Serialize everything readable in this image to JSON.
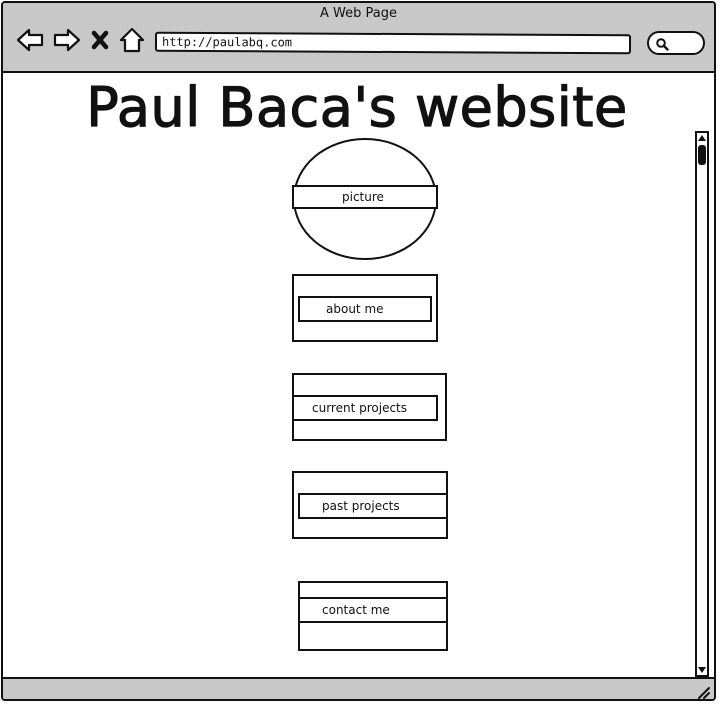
{
  "window": {
    "title": "A Web Page"
  },
  "toolbar": {
    "back_icon": "back-arrow-icon",
    "forward_icon": "forward-arrow-icon",
    "stop_icon": "close-icon",
    "home_icon": "home-icon",
    "url": "http://paulabq.com",
    "search_icon": "search-icon"
  },
  "page": {
    "title": "Paul Baca's website",
    "picture_label": "picture",
    "sections": [
      {
        "label": "about me"
      },
      {
        "label": "current projects"
      },
      {
        "label": "past projects"
      },
      {
        "label": "contact me"
      }
    ]
  },
  "colors": {
    "chrome": "#c8c8c8",
    "ink": "#111111",
    "background": "#ffffff"
  }
}
